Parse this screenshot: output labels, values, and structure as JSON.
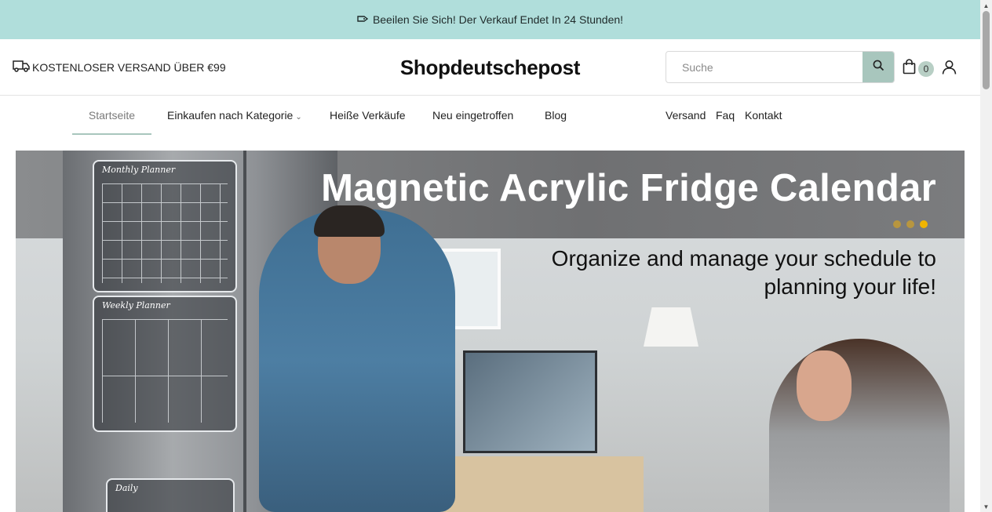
{
  "announcement": {
    "icon": "discount-tag-icon",
    "text": "Beeilen Sie Sich! Der Verkauf Endet In 24 Stunden!"
  },
  "header": {
    "shipping_icon": "truck-icon",
    "shipping_text": "KOSTENLOSER VERSAND ÜBER €99",
    "logo": "Shopdeutschepost",
    "search": {
      "placeholder": "Suche",
      "value": "",
      "button_icon": "search-icon"
    },
    "cart": {
      "icon": "shopping-bag-icon",
      "count": "0"
    },
    "account_icon": "user-icon"
  },
  "nav": {
    "left": [
      {
        "label": "Startseite",
        "active": true
      },
      {
        "label": "Einkaufen nach Kategorie",
        "has_dropdown": true
      },
      {
        "label": "Heiße Verkäufe"
      },
      {
        "label": "Neu eingetroffen"
      },
      {
        "label": "Blog"
      }
    ],
    "right": [
      {
        "label": "Versand"
      },
      {
        "label": "Faq"
      },
      {
        "label": "Kontakt"
      }
    ]
  },
  "hero": {
    "title": "Magnetic Acrylic Fridge Calendar",
    "subtitle": "Organize and manage your schedule to planning your life!",
    "panel_titles": [
      "Monthly Planner",
      "Weekly Planner",
      "Daily"
    ],
    "slides_total": 3,
    "active_slide": 3,
    "colors": {
      "dot_inactive": "#b8963f",
      "dot_active": "#f0b400"
    }
  },
  "colors": {
    "announcement_bg": "#b0dedb",
    "accent": "#a8c6bd"
  }
}
